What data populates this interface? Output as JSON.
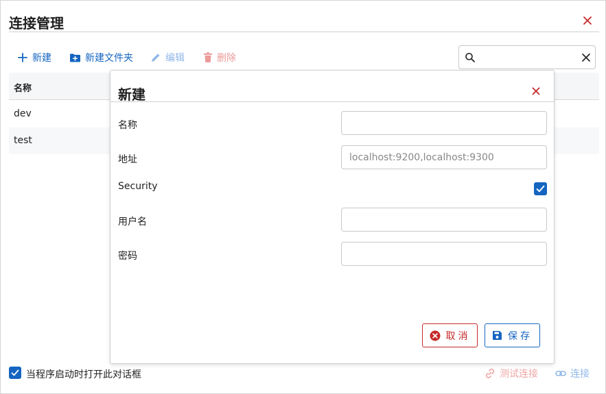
{
  "window": {
    "title": "连接管理"
  },
  "toolbar": {
    "new_label": "新建",
    "new_folder_label": "新建文件夹",
    "edit_label": "编辑",
    "delete_label": "删除"
  },
  "search": {
    "value": "",
    "placeholder": ""
  },
  "table": {
    "columns": [
      "名称"
    ],
    "rows": [
      {
        "name": "dev"
      },
      {
        "name": "test"
      }
    ]
  },
  "footer": {
    "open_on_start_label": "当程序启动时打开此对话框",
    "open_on_start_checked": true,
    "test_connection_label": "测试连接",
    "connect_label": "连接"
  },
  "dialog": {
    "title": "新建",
    "fields": {
      "name_label": "名称",
      "name_value": "",
      "address_label": "地址",
      "address_placeholder": "localhost:9200,localhost:9300",
      "security_label": "Security",
      "security_checked": true,
      "username_label": "用户名",
      "username_value": "",
      "password_label": "密码",
      "password_value": ""
    },
    "cancel_label": "取消",
    "save_label": "保存"
  },
  "colors": {
    "primary": "#1565c0",
    "danger": "#c62828",
    "primary_disabled": "#8fb7e8",
    "danger_disabled": "#eb9a9a"
  }
}
